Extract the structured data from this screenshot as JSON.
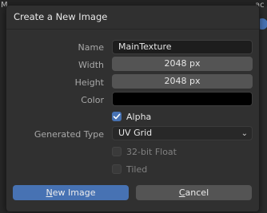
{
  "background": {
    "fragment_left": "M",
    "fragment_right": "ac"
  },
  "dialog": {
    "title": "Create a New Image",
    "fields": {
      "name": {
        "label": "Name",
        "value": "MainTexture"
      },
      "width": {
        "label": "Width",
        "value": "2048 px"
      },
      "height": {
        "label": "Height",
        "value": "2048 px"
      },
      "color": {
        "label": "Color",
        "value_hex": "#000000"
      },
      "alpha": {
        "label": "Alpha",
        "checked": true
      },
      "generated_type": {
        "label": "Generated Type",
        "value": "UV Grid"
      },
      "float32": {
        "label": "32-bit Float",
        "checked": false
      },
      "tiled": {
        "label": "Tiled",
        "checked": false
      }
    },
    "buttons": {
      "confirm": {
        "first": "N",
        "rest": "ew Image"
      },
      "cancel": {
        "first": "C",
        "rest": "ancel"
      }
    }
  },
  "colors": {
    "accent": "#4772b3",
    "dialog_bg": "#303030",
    "field_bg": "#545454"
  }
}
